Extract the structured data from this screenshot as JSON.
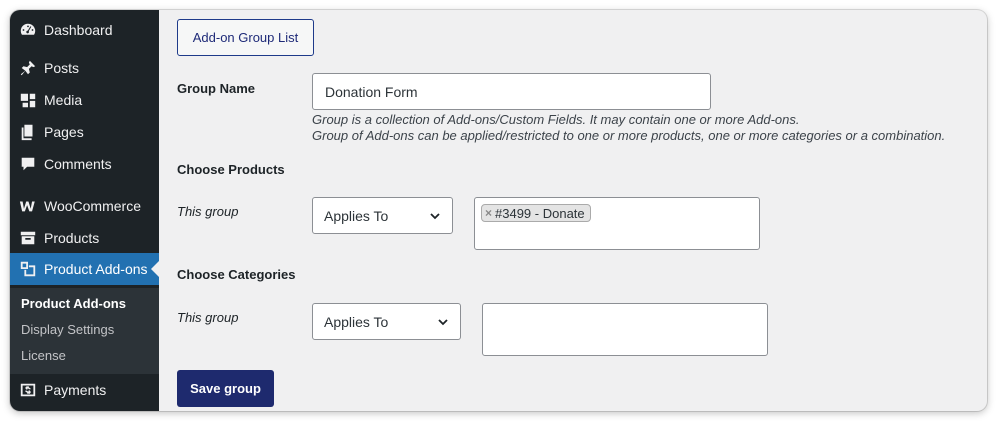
{
  "sidebar": {
    "items": [
      {
        "label": "Dashboard",
        "icon": "dashboard-icon"
      },
      {
        "label": "Posts",
        "icon": "pin-icon"
      },
      {
        "label": "Media",
        "icon": "media-icon"
      },
      {
        "label": "Pages",
        "icon": "pages-icon"
      },
      {
        "label": "Comments",
        "icon": "comment-icon"
      },
      {
        "label": "WooCommerce",
        "icon": "woocommerce-icon"
      },
      {
        "label": "Products",
        "icon": "archive-icon"
      },
      {
        "label": "Product Add-ons",
        "icon": "addons-icon",
        "active": true
      },
      {
        "label": "Payments",
        "icon": "dollar-icon"
      }
    ],
    "submenu": [
      {
        "label": "Product Add-ons",
        "current": true
      },
      {
        "label": "Display Settings"
      },
      {
        "label": "License"
      }
    ]
  },
  "main": {
    "list_button": "Add-on Group List",
    "group_name_label": "Group Name",
    "group_name_value": "Donation Form",
    "group_desc_1": "Group is a collection of Add-ons/Custom Fields. It may contain one or more Add-ons.",
    "group_desc_2": "Group of Add-ons can be applied/restricted to one or more products, one or more categories or a combination.",
    "products": {
      "heading": "Choose Products",
      "this_group": "This group",
      "select_value": "Applies To",
      "tags": [
        "#3499 - Donate"
      ]
    },
    "categories": {
      "heading": "Choose Categories",
      "this_group": "This group",
      "select_value": "Applies To"
    },
    "save_button": "Save group"
  },
  "colors": {
    "sidebar_bg": "#1d2327",
    "active_bg": "#2271b1",
    "primary_button": "#1e2a6e"
  }
}
